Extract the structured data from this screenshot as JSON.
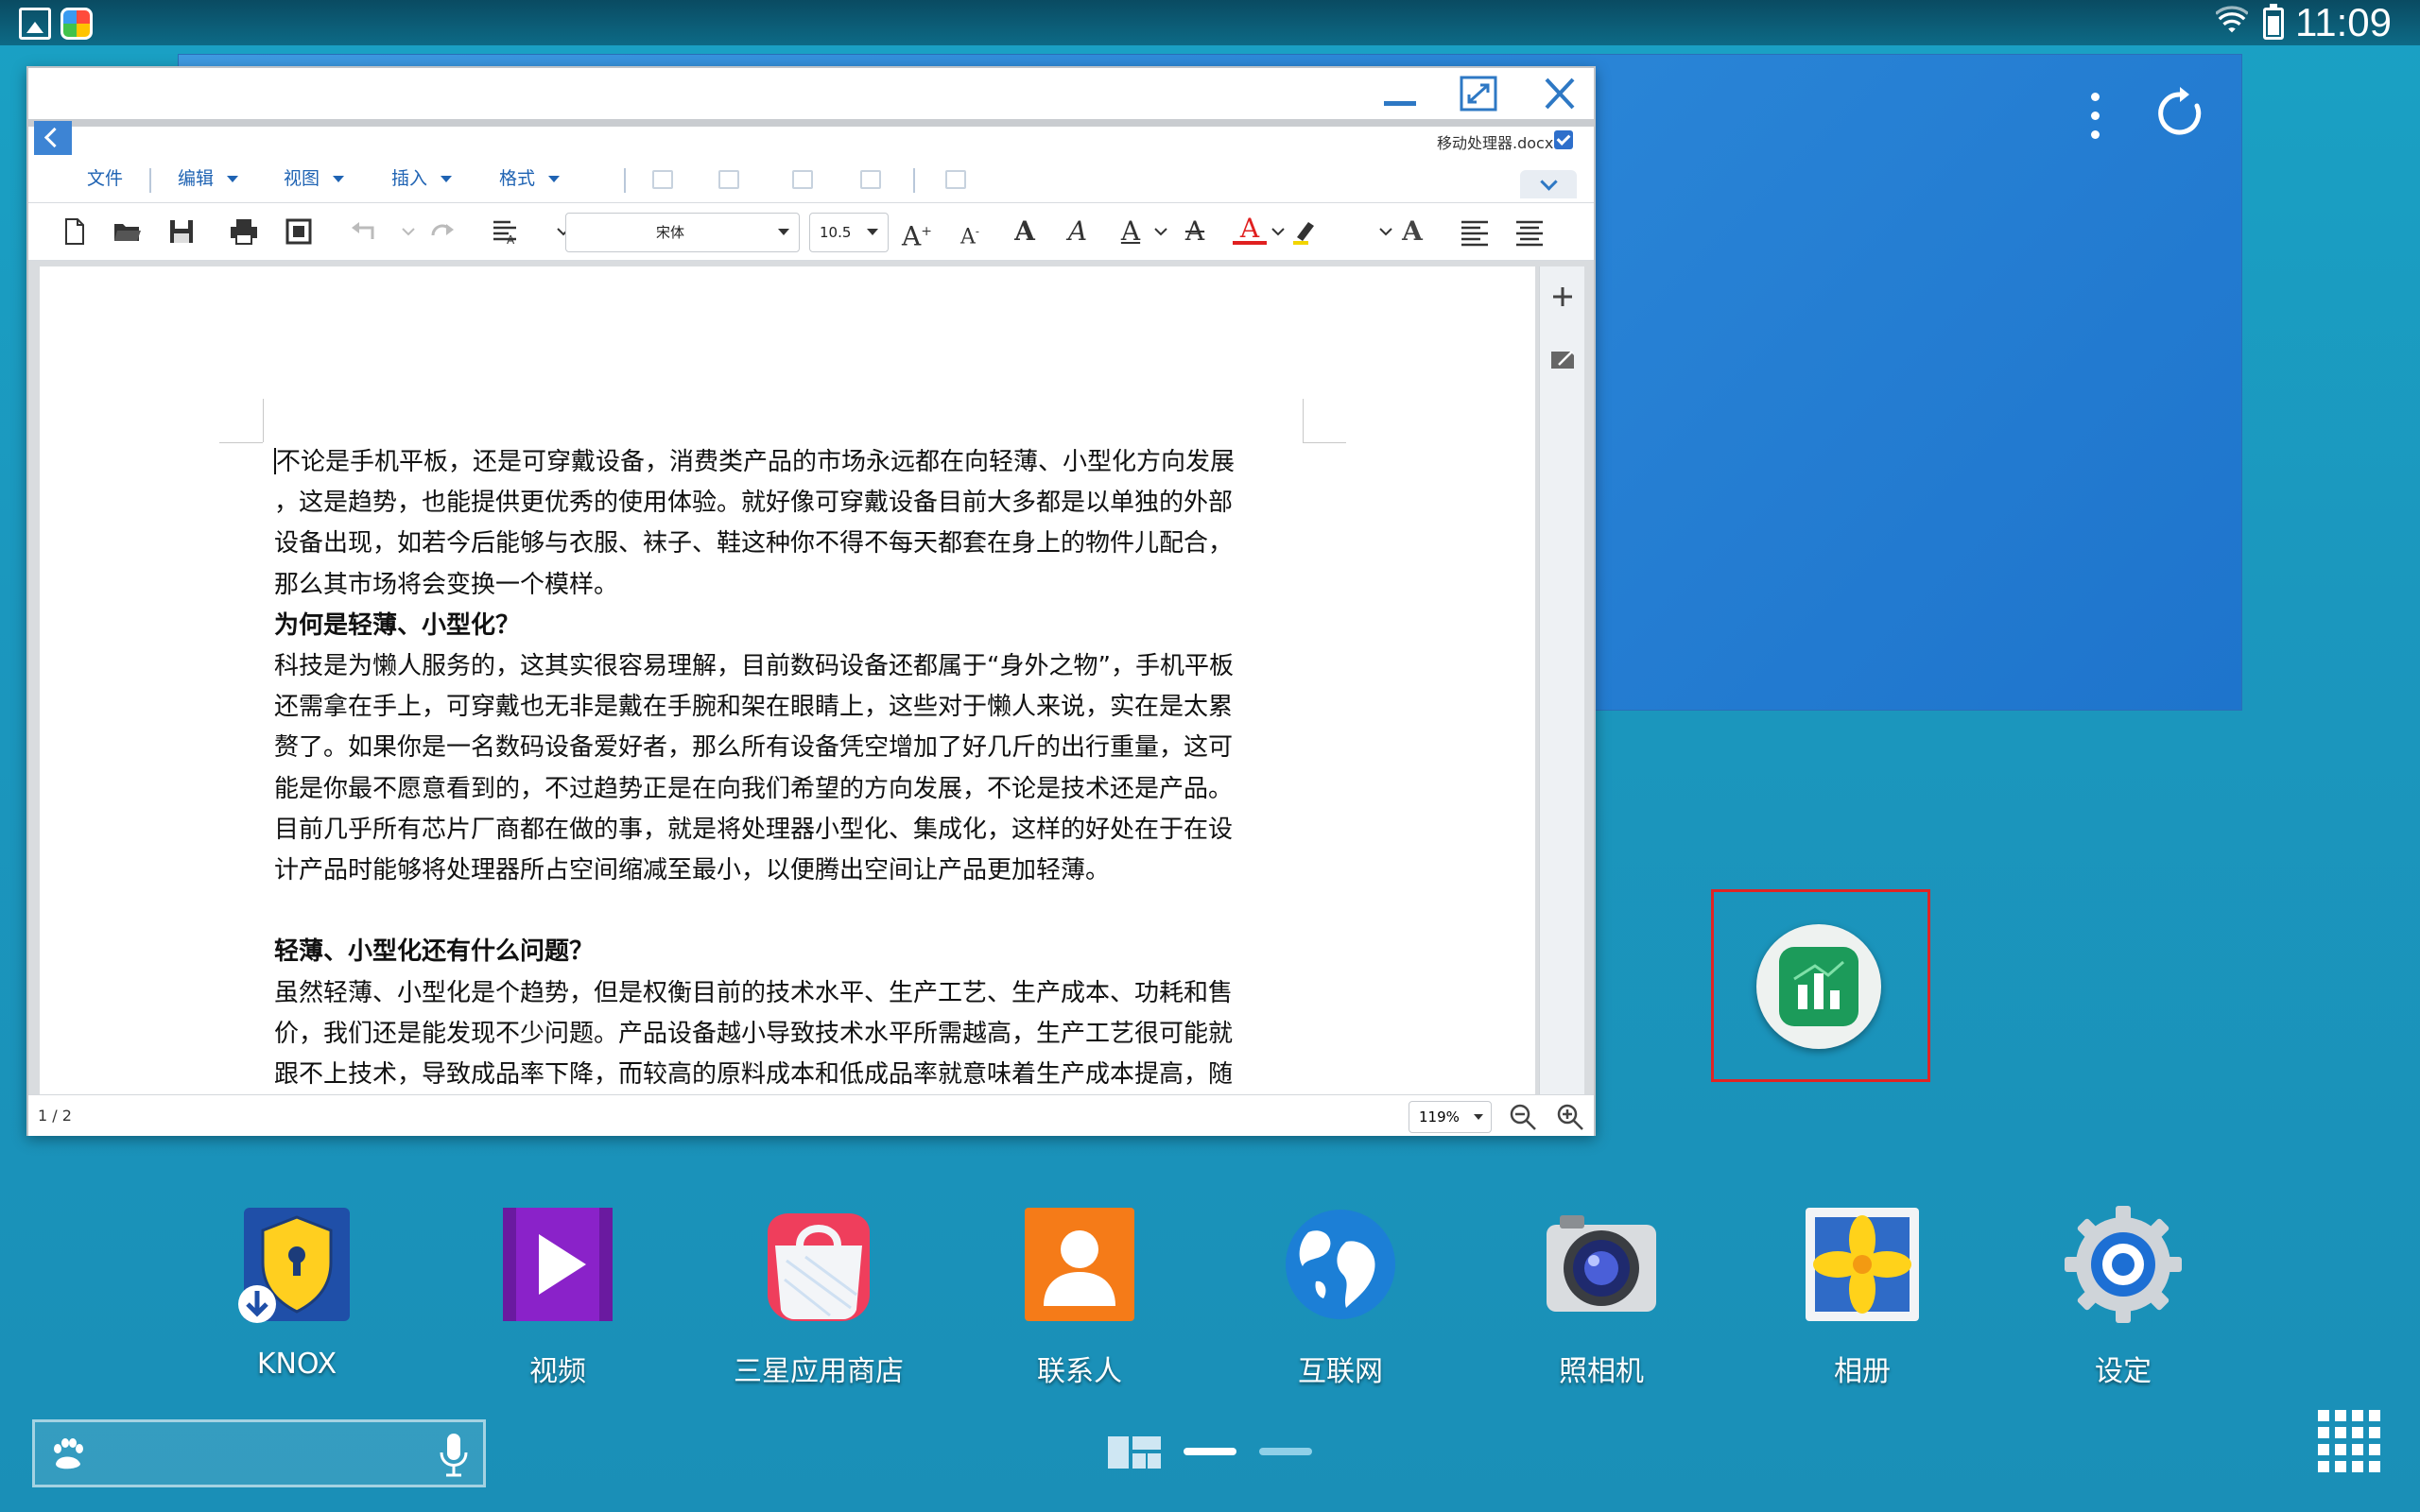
{
  "status_bar": {
    "time": "11:09",
    "icons": [
      "gallery-notification-icon",
      "app-notification-icon",
      "wifi-icon",
      "battery-icon"
    ]
  },
  "document_window": {
    "filename": "移动处理器.docx",
    "menus": [
      {
        "label": "文件"
      },
      {
        "label": "编辑"
      },
      {
        "label": "视图"
      },
      {
        "label": "插入"
      },
      {
        "label": "格式"
      }
    ],
    "font": "宋体",
    "font_size": "10.5",
    "paragraphs": [
      {
        "type": "body",
        "text": "不论是手机平板，还是可穿戴设备，消费类产品的市场永远都在向轻薄、小型化方向发展"
      },
      {
        "type": "body",
        "text": "，这是趋势，也能提供更优秀的使用体验。就好像可穿戴设备目前大多都是以单独的外部"
      },
      {
        "type": "body",
        "text": "设备出现，如若今后能够与衣服、袜子、鞋这种你不得不每天都套在身上的物件儿配合，"
      },
      {
        "type": "body",
        "text": "那么其市场将会变换一个模样。"
      },
      {
        "type": "heading",
        "text": "为何是轻薄、小型化？"
      },
      {
        "type": "body",
        "text": "科技是为懒人服务的，这其实很容易理解，目前数码设备还都属于“身外之物”，手机平板"
      },
      {
        "type": "body",
        "text": "还需拿在手上，可穿戴也无非是戴在手腕和架在眼睛上，这些对于懒人来说，实在是太累"
      },
      {
        "type": "body",
        "text": "赘了。如果你是一名数码设备爱好者，那么所有设备凭空增加了好几斤的出行重量，这可"
      },
      {
        "type": "body",
        "text": "能是你最不愿意看到的，不过趋势正是在向我们希望的方向发展，不论是技术还是产品。"
      },
      {
        "type": "body",
        "text": "目前几乎所有芯片厂商都在做的事，就是将处理器小型化、集成化，这样的好处在于在设"
      },
      {
        "type": "body",
        "text": "计产品时能够将处理器所占空间缩减至最小，以便腾出空间让产品更加轻薄。"
      },
      {
        "type": "gap",
        "text": ""
      },
      {
        "type": "heading",
        "text": "轻薄、小型化还有什么问题？"
      },
      {
        "type": "body",
        "text": "虽然轻薄、小型化是个趋势，但是权衡目前的技术水平、生产工艺、生产成本、功耗和售"
      },
      {
        "type": "body",
        "text": "价，我们还是能发现不少问题。产品设备越小导致技术水平所需越高，生产工艺很可能就"
      },
      {
        "type": "body",
        "text": "跟不上技术，导致成品率下降，而较高的原料成本和低成品率就意味着生产成本提高，随"
      }
    ],
    "page_indicator": "1 / 2",
    "zoom": "119%"
  },
  "dock": [
    {
      "label": "KNOX",
      "icon": "knox-shield-icon"
    },
    {
      "label": "视频",
      "icon": "video-play-icon"
    },
    {
      "label": "三星应用商店",
      "icon": "galaxy-store-bag-icon"
    },
    {
      "label": "联系人",
      "icon": "contacts-person-icon"
    },
    {
      "label": "互联网",
      "icon": "internet-globe-icon"
    },
    {
      "label": "照相机",
      "icon": "camera-icon"
    },
    {
      "label": "相册",
      "icon": "gallery-flower-icon"
    },
    {
      "label": "设定",
      "icon": "settings-gear-icon"
    }
  ],
  "highlighted_app": {
    "icon": "spreadsheet-chart-icon",
    "highlight_color": "#e02424"
  },
  "colors": {
    "accent": "#2e78c4",
    "wallpaper": "#1a97be",
    "panel": "#2b87d8"
  }
}
